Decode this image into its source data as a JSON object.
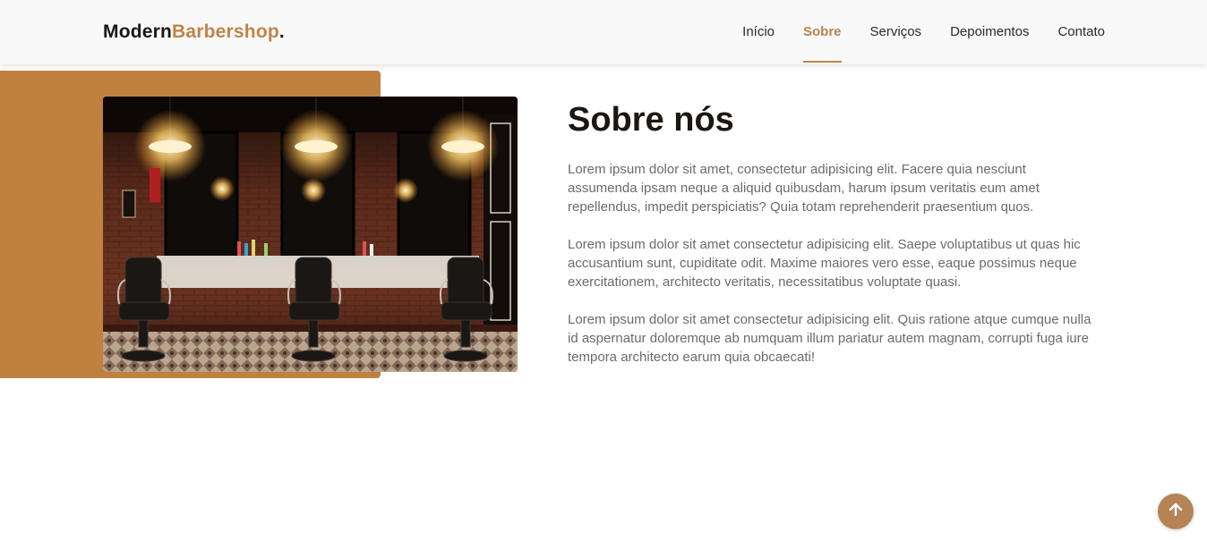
{
  "brand": {
    "name_part1": "Modern",
    "name_part2": "Barbershop",
    "name_suffix": ".",
    "accent_color": "#c0844a"
  },
  "nav": {
    "items": [
      {
        "label": "Início",
        "active": false
      },
      {
        "label": "Sobre",
        "active": true
      },
      {
        "label": "Serviços",
        "active": false
      },
      {
        "label": "Depoimentos",
        "active": false
      },
      {
        "label": "Contato",
        "active": false
      }
    ]
  },
  "about": {
    "title": "Sobre nós",
    "paragraphs": [
      "Lorem ipsum dolor sit amet, consectetur adipisicing elit. Facere quia nesciunt assumenda ipsam neque a aliquid quibusdam, harum ipsum veritatis eum amet repellendus, impedit perspiciatis? Quia totam reprehenderit praesentium quos.",
      "Lorem ipsum dolor sit amet consectetur adipisicing elit. Saepe voluptatibus ut quas hic accusantium sunt, cupiditate odit. Maxime maiores vero esse, eaque possimus neque exercitationem, architecto veritatis, necessitatibus voluptate quasi.",
      "Lorem ipsum dolor sit amet consectetur adipisicing elit. Quis ratione atque cumque nulla id aspernatur doloremque ab numquam illum pariatur autem magnam, corrupti fuga iure tempora architecto earum quia obcaecati!"
    ],
    "image_icon": "barbershop-interior-photo"
  },
  "back_to_top": {
    "icon": "arrow-up-icon"
  }
}
